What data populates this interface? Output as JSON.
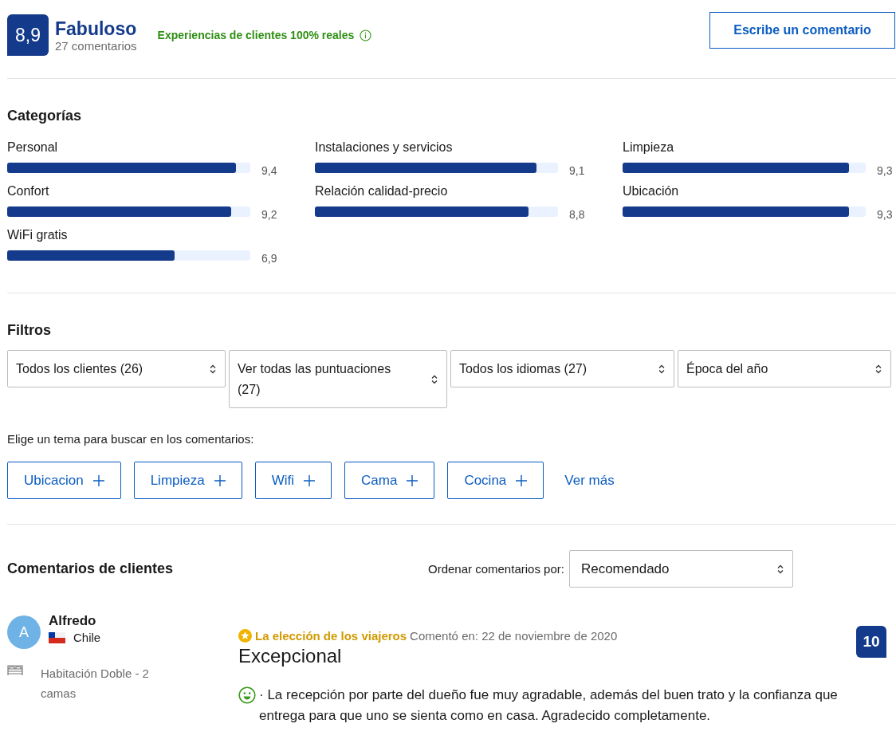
{
  "summary": {
    "score": "8,9",
    "rating": "Fabuloso",
    "count": "27 comentarios",
    "verified": "Experiencias de clientes 100% reales",
    "write_button": "Escribe un comentario"
  },
  "categories": {
    "title": "Categorías",
    "items": [
      {
        "label": "Personal",
        "level": 0.94,
        "value": "9,4"
      },
      {
        "label": "Instalaciones y servicios",
        "level": 0.91,
        "value": "9,1"
      },
      {
        "label": "Limpieza",
        "level": 0.93,
        "value": "9,3"
      },
      {
        "label": "Confort",
        "level": 0.92,
        "value": "9,2"
      },
      {
        "label": "Relación calidad-precio",
        "level": 0.88,
        "value": "8,8"
      },
      {
        "label": "Ubicación",
        "level": 0.93,
        "value": "9,3"
      },
      {
        "label": "WiFi gratis",
        "level": 0.69,
        "value": "6,9"
      }
    ]
  },
  "filters": {
    "title": "Filtros",
    "selects": [
      {
        "value": "Todos los clientes (26)"
      },
      {
        "value": "Ver todas las puntuaciones (27)"
      },
      {
        "value": "Todos los idiomas (27)"
      },
      {
        "value": "Época del año"
      }
    ],
    "topic_prompt": "Elige un tema para buscar en los comentarios:",
    "topics": [
      "Ubicacion",
      "Limpieza",
      "Wifi",
      "Cama",
      "Cocina"
    ],
    "more": "Ver más"
  },
  "reviews": {
    "title": "Comentarios de clientes",
    "sort_label": "Ordenar comentarios por:",
    "sort_value": "Recomendado",
    "items": [
      {
        "initial": "A",
        "name": "Alfredo",
        "country": "Chile",
        "room": "Habitación Doble - 2 camas",
        "badge": "La elección de los viajeros",
        "date": "Comentó en: 22 de noviembre de 2020",
        "headline": "Excepcional",
        "score": "10",
        "text": "· La recepción por parte del dueño fue muy agradable, además del buen trato y la confianza que entrega para que uno se sienta como en casa. Agradecido completamente."
      }
    ]
  }
}
